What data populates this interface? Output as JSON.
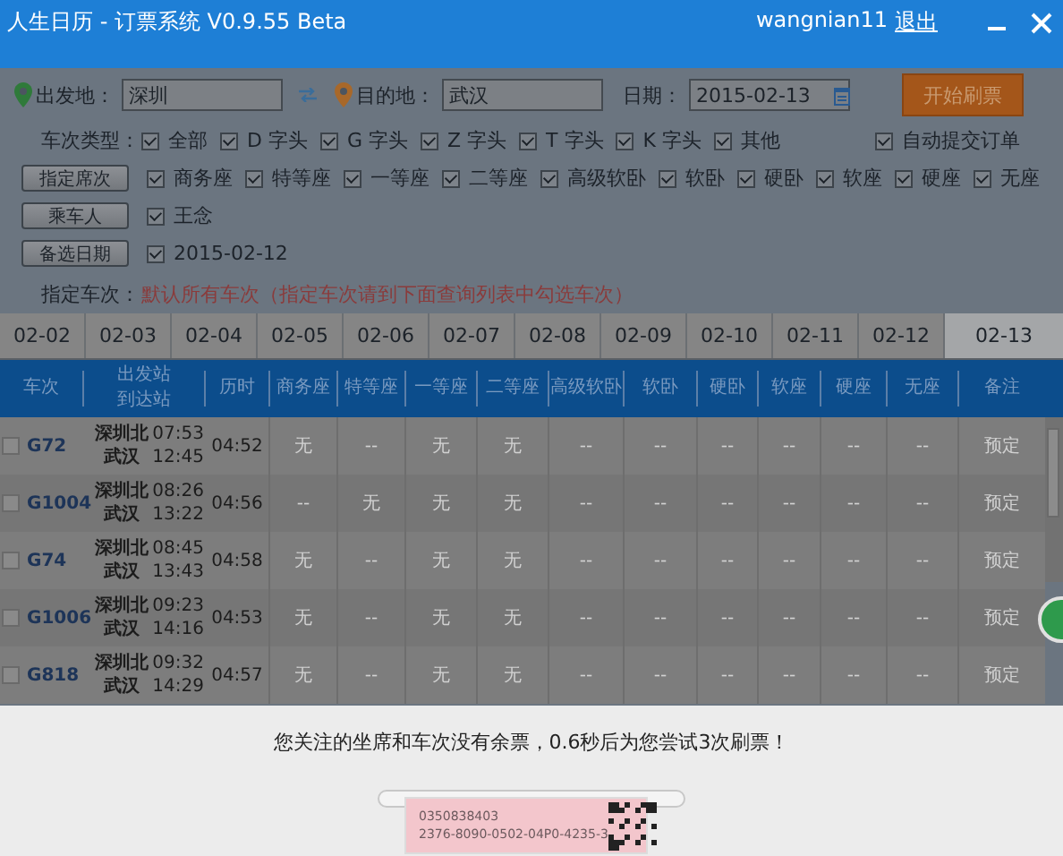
{
  "window": {
    "title": "人生日历 - 订票系统 V0.9.55 Beta",
    "user": "wangnian11",
    "logout": "退出"
  },
  "form": {
    "origin": {
      "label": "出发地：",
      "value": "深圳"
    },
    "destination": {
      "label": "目的地：",
      "value": "武汉"
    },
    "date": {
      "label": "日期：",
      "value": "2015-02-13"
    },
    "start_button": "开始刷票",
    "train_types": {
      "label": "车次类型：",
      "options": [
        {
          "label": "全部",
          "checked": true
        },
        {
          "label": "D 字头",
          "checked": true
        },
        {
          "label": "G 字头",
          "checked": true
        },
        {
          "label": "Z 字头",
          "checked": true
        },
        {
          "label": "T 字头",
          "checked": true
        },
        {
          "label": "K 字头",
          "checked": true
        },
        {
          "label": "其他",
          "checked": true
        }
      ]
    },
    "auto_submit": {
      "label": "自动提交订单",
      "checked": true
    },
    "seat_button": "指定席次",
    "seats": [
      {
        "label": "商务座",
        "checked": true
      },
      {
        "label": "特等座",
        "checked": true
      },
      {
        "label": "一等座",
        "checked": true
      },
      {
        "label": "二等座",
        "checked": true
      },
      {
        "label": "高级软卧",
        "checked": true
      },
      {
        "label": "软卧",
        "checked": true
      },
      {
        "label": "硬卧",
        "checked": true
      },
      {
        "label": "软座",
        "checked": true
      },
      {
        "label": "硬座",
        "checked": true
      },
      {
        "label": "无座",
        "checked": true
      }
    ],
    "passenger_button": "乘车人",
    "passengers": [
      {
        "label": "王念",
        "checked": true
      }
    ],
    "alt_date_button": "备选日期",
    "alt_dates": [
      {
        "label": "2015-02-12",
        "checked": true
      }
    ],
    "train_filter": {
      "label": "指定车次：",
      "value": "默认所有车次（指定车次请到下面查询列表中勾选车次）"
    }
  },
  "date_tabs": [
    {
      "label": "02-02",
      "selected": false
    },
    {
      "label": "02-03",
      "selected": false
    },
    {
      "label": "02-04",
      "selected": false
    },
    {
      "label": "02-05",
      "selected": false
    },
    {
      "label": "02-06",
      "selected": false
    },
    {
      "label": "02-07",
      "selected": false
    },
    {
      "label": "02-08",
      "selected": false
    },
    {
      "label": "02-09",
      "selected": false
    },
    {
      "label": "02-10",
      "selected": false
    },
    {
      "label": "02-11",
      "selected": false
    },
    {
      "label": "02-12",
      "selected": false
    },
    {
      "label": "02-13",
      "selected": true
    }
  ],
  "table": {
    "columns": [
      [
        "车次"
      ],
      [
        "出发站",
        "到达站"
      ],
      [
        "历时"
      ],
      [
        "商务座"
      ],
      [
        "特等座"
      ],
      [
        "一等座"
      ],
      [
        "二等座"
      ],
      [
        "高级软卧"
      ],
      [
        "软卧"
      ],
      [
        "硬卧"
      ],
      [
        "软座"
      ],
      [
        "硬座"
      ],
      [
        "无座"
      ],
      [
        "备注"
      ]
    ],
    "rows": [
      {
        "checked": false,
        "train": "G72",
        "from": "深圳北",
        "to": "武汉",
        "depart": "07:53",
        "arrive": "12:45",
        "duration": "04:52",
        "seats": [
          "无",
          "--",
          "无",
          "无",
          "--",
          "--",
          "--",
          "--",
          "--",
          "--"
        ],
        "note": "预定"
      },
      {
        "checked": false,
        "train": "G1004",
        "from": "深圳北",
        "to": "武汉",
        "depart": "08:26",
        "arrive": "13:22",
        "duration": "04:56",
        "seats": [
          "--",
          "无",
          "无",
          "无",
          "--",
          "--",
          "--",
          "--",
          "--",
          "--"
        ],
        "note": "预定"
      },
      {
        "checked": false,
        "train": "G74",
        "from": "深圳北",
        "to": "武汉",
        "depart": "08:45",
        "arrive": "13:43",
        "duration": "04:58",
        "seats": [
          "无",
          "--",
          "无",
          "无",
          "--",
          "--",
          "--",
          "--",
          "--",
          "--"
        ],
        "note": "预定"
      },
      {
        "checked": false,
        "train": "G1006",
        "from": "深圳北",
        "to": "武汉",
        "depart": "09:23",
        "arrive": "14:16",
        "duration": "04:53",
        "seats": [
          "无",
          "--",
          "无",
          "无",
          "--",
          "--",
          "--",
          "--",
          "--",
          "--"
        ],
        "note": "预定"
      },
      {
        "checked": false,
        "train": "G818",
        "from": "深圳北",
        "to": "武汉",
        "depart": "09:32",
        "arrive": "14:29",
        "duration": "04:57",
        "seats": [
          "无",
          "--",
          "无",
          "无",
          "--",
          "--",
          "--",
          "--",
          "--",
          "--"
        ],
        "note": "预定"
      }
    ]
  },
  "notice": {
    "message": "您关注的坐席和车次没有余票，0.6秒后为您尝试3次刷票！",
    "ticket_lines": [
      "0350838403",
      "2376-8090-0502-04P0-4235-3"
    ]
  }
}
